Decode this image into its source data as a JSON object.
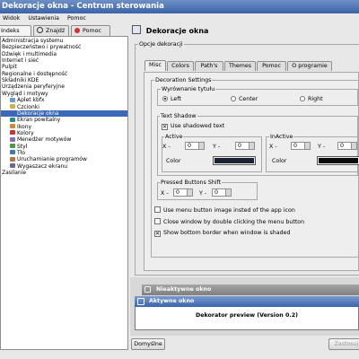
{
  "window": {
    "title": "Dekoracje okna - Centrum sterowania"
  },
  "menubar": {
    "items": [
      "Widok",
      "Ustawienia",
      "Pomoc"
    ]
  },
  "left_tabs": [
    "Indeks",
    "Znajdź",
    "Pomoc"
  ],
  "tree": [
    {
      "label": "Administracja systemu",
      "indent": 0
    },
    {
      "label": "Bezpieczeństwo i prywatność",
      "indent": 0
    },
    {
      "label": "Dźwięk i multimedia",
      "indent": 0
    },
    {
      "label": "Internet i sieć",
      "indent": 0
    },
    {
      "label": "Pulpit",
      "indent": 0
    },
    {
      "label": "Regionalne i dostępność",
      "indent": 0
    },
    {
      "label": "Składniki KDE",
      "indent": 0
    },
    {
      "label": "Urządzenia peryferyjne",
      "indent": 0
    },
    {
      "label": "Wygląd i motywy",
      "indent": 0
    },
    {
      "label": "Aplet kbfx",
      "indent": 1
    },
    {
      "label": "Czcionki",
      "indent": 1
    },
    {
      "label": "Dekoracje okna",
      "indent": 1,
      "selected": true
    },
    {
      "label": "Ekran powitalny",
      "indent": 1
    },
    {
      "label": "Ikony",
      "indent": 1
    },
    {
      "label": "Kolory",
      "indent": 1
    },
    {
      "label": "Menedżer motywów",
      "indent": 1
    },
    {
      "label": "Styl",
      "indent": 1
    },
    {
      "label": "Tło",
      "indent": 1
    },
    {
      "label": "Uruchamianie programów",
      "indent": 1
    },
    {
      "label": "Wygaszacz ekranu",
      "indent": 1
    },
    {
      "label": "Zasilanie",
      "indent": 0
    }
  ],
  "module": {
    "title": "Dekoracje okna"
  },
  "options_group": {
    "label": "Opcje dekoracji"
  },
  "tabs": [
    "Misc",
    "Colors",
    "Path's",
    "Themes",
    "Pomoc",
    "O programie"
  ],
  "decoration_settings": {
    "label": "Decoration Settings",
    "title_alignment": {
      "label": "Wyrównanie tytułu",
      "options": [
        "Left",
        "Center",
        "Right"
      ],
      "selected": "Left"
    }
  },
  "text_shadow": {
    "label": "Text Shadow",
    "use_shadowed": {
      "label": "Use shadowed text",
      "checked": true
    },
    "active": {
      "label": "Active",
      "x_label": "X -",
      "x": "0",
      "y_label": "Y -",
      "y": "0",
      "color_label": "Color",
      "color": "#1a2233"
    },
    "inactive": {
      "label": "InActive",
      "x_label": "X -",
      "x": "0",
      "y_label": "Y -",
      "y": "0",
      "color_label": "Color",
      "color": "#0a0a0a"
    }
  },
  "pressed_shift": {
    "label": "Pressed Buttons Shift",
    "x_label": "X -",
    "x": "0",
    "y_label": "Y -",
    "y": "0"
  },
  "checkboxes": [
    {
      "label": "Use menu button image insted of the app icon",
      "checked": false
    },
    {
      "label": "Close window by double clicking the menu button",
      "checked": false
    },
    {
      "label": "Show bottom border when window is shaded",
      "checked": true
    }
  ],
  "preview": {
    "inactive_title": "Nieaktywne okno",
    "active_title": "Aktywne okno",
    "caption": "Dekorator preview (Version 0.2)"
  },
  "buttons": {
    "defaults": "Domyślne",
    "apply": "Zastosuj"
  }
}
